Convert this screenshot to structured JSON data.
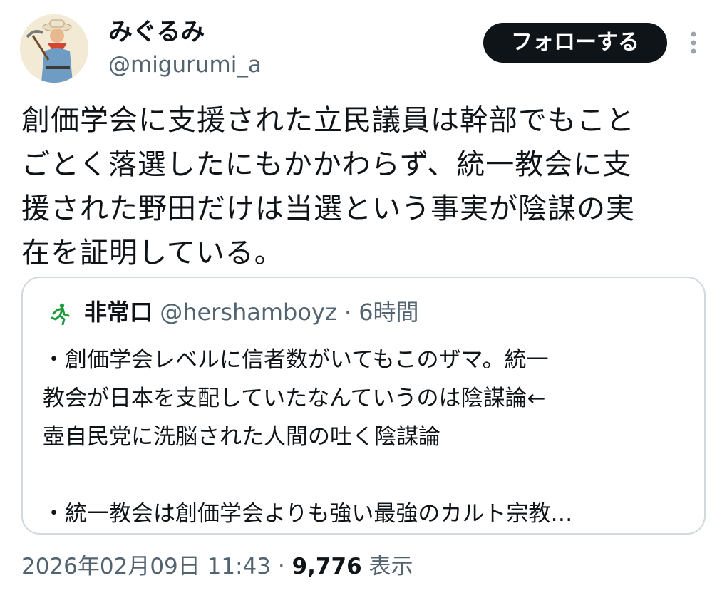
{
  "author": {
    "display_name": "みぐるみ",
    "handle": "@migurumi_a"
  },
  "follow_button": {
    "label": "フォローする"
  },
  "post": {
    "text": "創価学会に支援された立民議員は幹部でもこと\nごとく落選したにもかかわらず、統一教会に支\n援された野田だけは当選という事実が陰謀の実\n在を証明している。"
  },
  "quote": {
    "display_name": "非常口",
    "handle": "@hershamboyz",
    "separator": "·",
    "time": "6時間",
    "text": "・創価学会レベルに信者数がいてもこのザマ。統一\n教会が日本を支配していたなんていうのは陰謀論←\n壺自民党に洗脳された人間の吐く陰謀論\n\n・統一教会は創価学会よりも強い最強のカルト宗教…"
  },
  "meta": {
    "date": "2026年02月09日",
    "time": "11:43",
    "separator": "·",
    "views_count": "9,776",
    "views_label": "表示"
  },
  "icons": {
    "avatar": "avatar-illustration",
    "more": "more-vertical-icon",
    "exit": "emergency-exit-icon"
  },
  "colors": {
    "text_primary": "#0f1419",
    "text_secondary": "#536471",
    "button_bg": "#0f1419",
    "button_text": "#ffffff",
    "border": "#cfd9de",
    "exit_icon_green": "#1f9a3c"
  }
}
